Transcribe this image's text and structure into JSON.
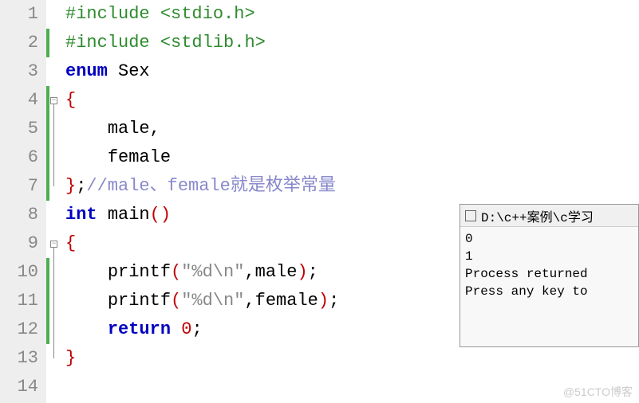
{
  "lines": {
    "1": "1",
    "2": "2",
    "3": "3",
    "4": "4",
    "5": "5",
    "6": "6",
    "7": "7",
    "8": "8",
    "9": "9",
    "10": "10",
    "11": "11",
    "12": "12",
    "13": "13",
    "14": "14"
  },
  "code": {
    "kw_include": "#include",
    "hdr_stdio": "<stdio.h>",
    "hdr_stdlib": "<stdlib.h>",
    "kw_enum": "enum",
    "id_sex": "Sex",
    "brace_open": "{",
    "brace_close": "}",
    "id_male": "male",
    "id_female": "female",
    "comma": ",",
    "semicolon": ";",
    "comment_enum": "//male、female就是枚举常量",
    "kw_int": "int",
    "id_main": "main",
    "paren_open": "(",
    "paren_close": ")",
    "id_printf": "printf",
    "str_fmt": "\"%d\\n\"",
    "kw_return": "return",
    "num_zero": "0",
    "fold_minus": "−"
  },
  "console": {
    "title": "D:\\c++案例\\c学习",
    "out1": "0",
    "out2": "1",
    "blank": "",
    "msg1": "Process returned",
    "msg2": "Press any key to"
  },
  "watermark": "@51CTO博客"
}
